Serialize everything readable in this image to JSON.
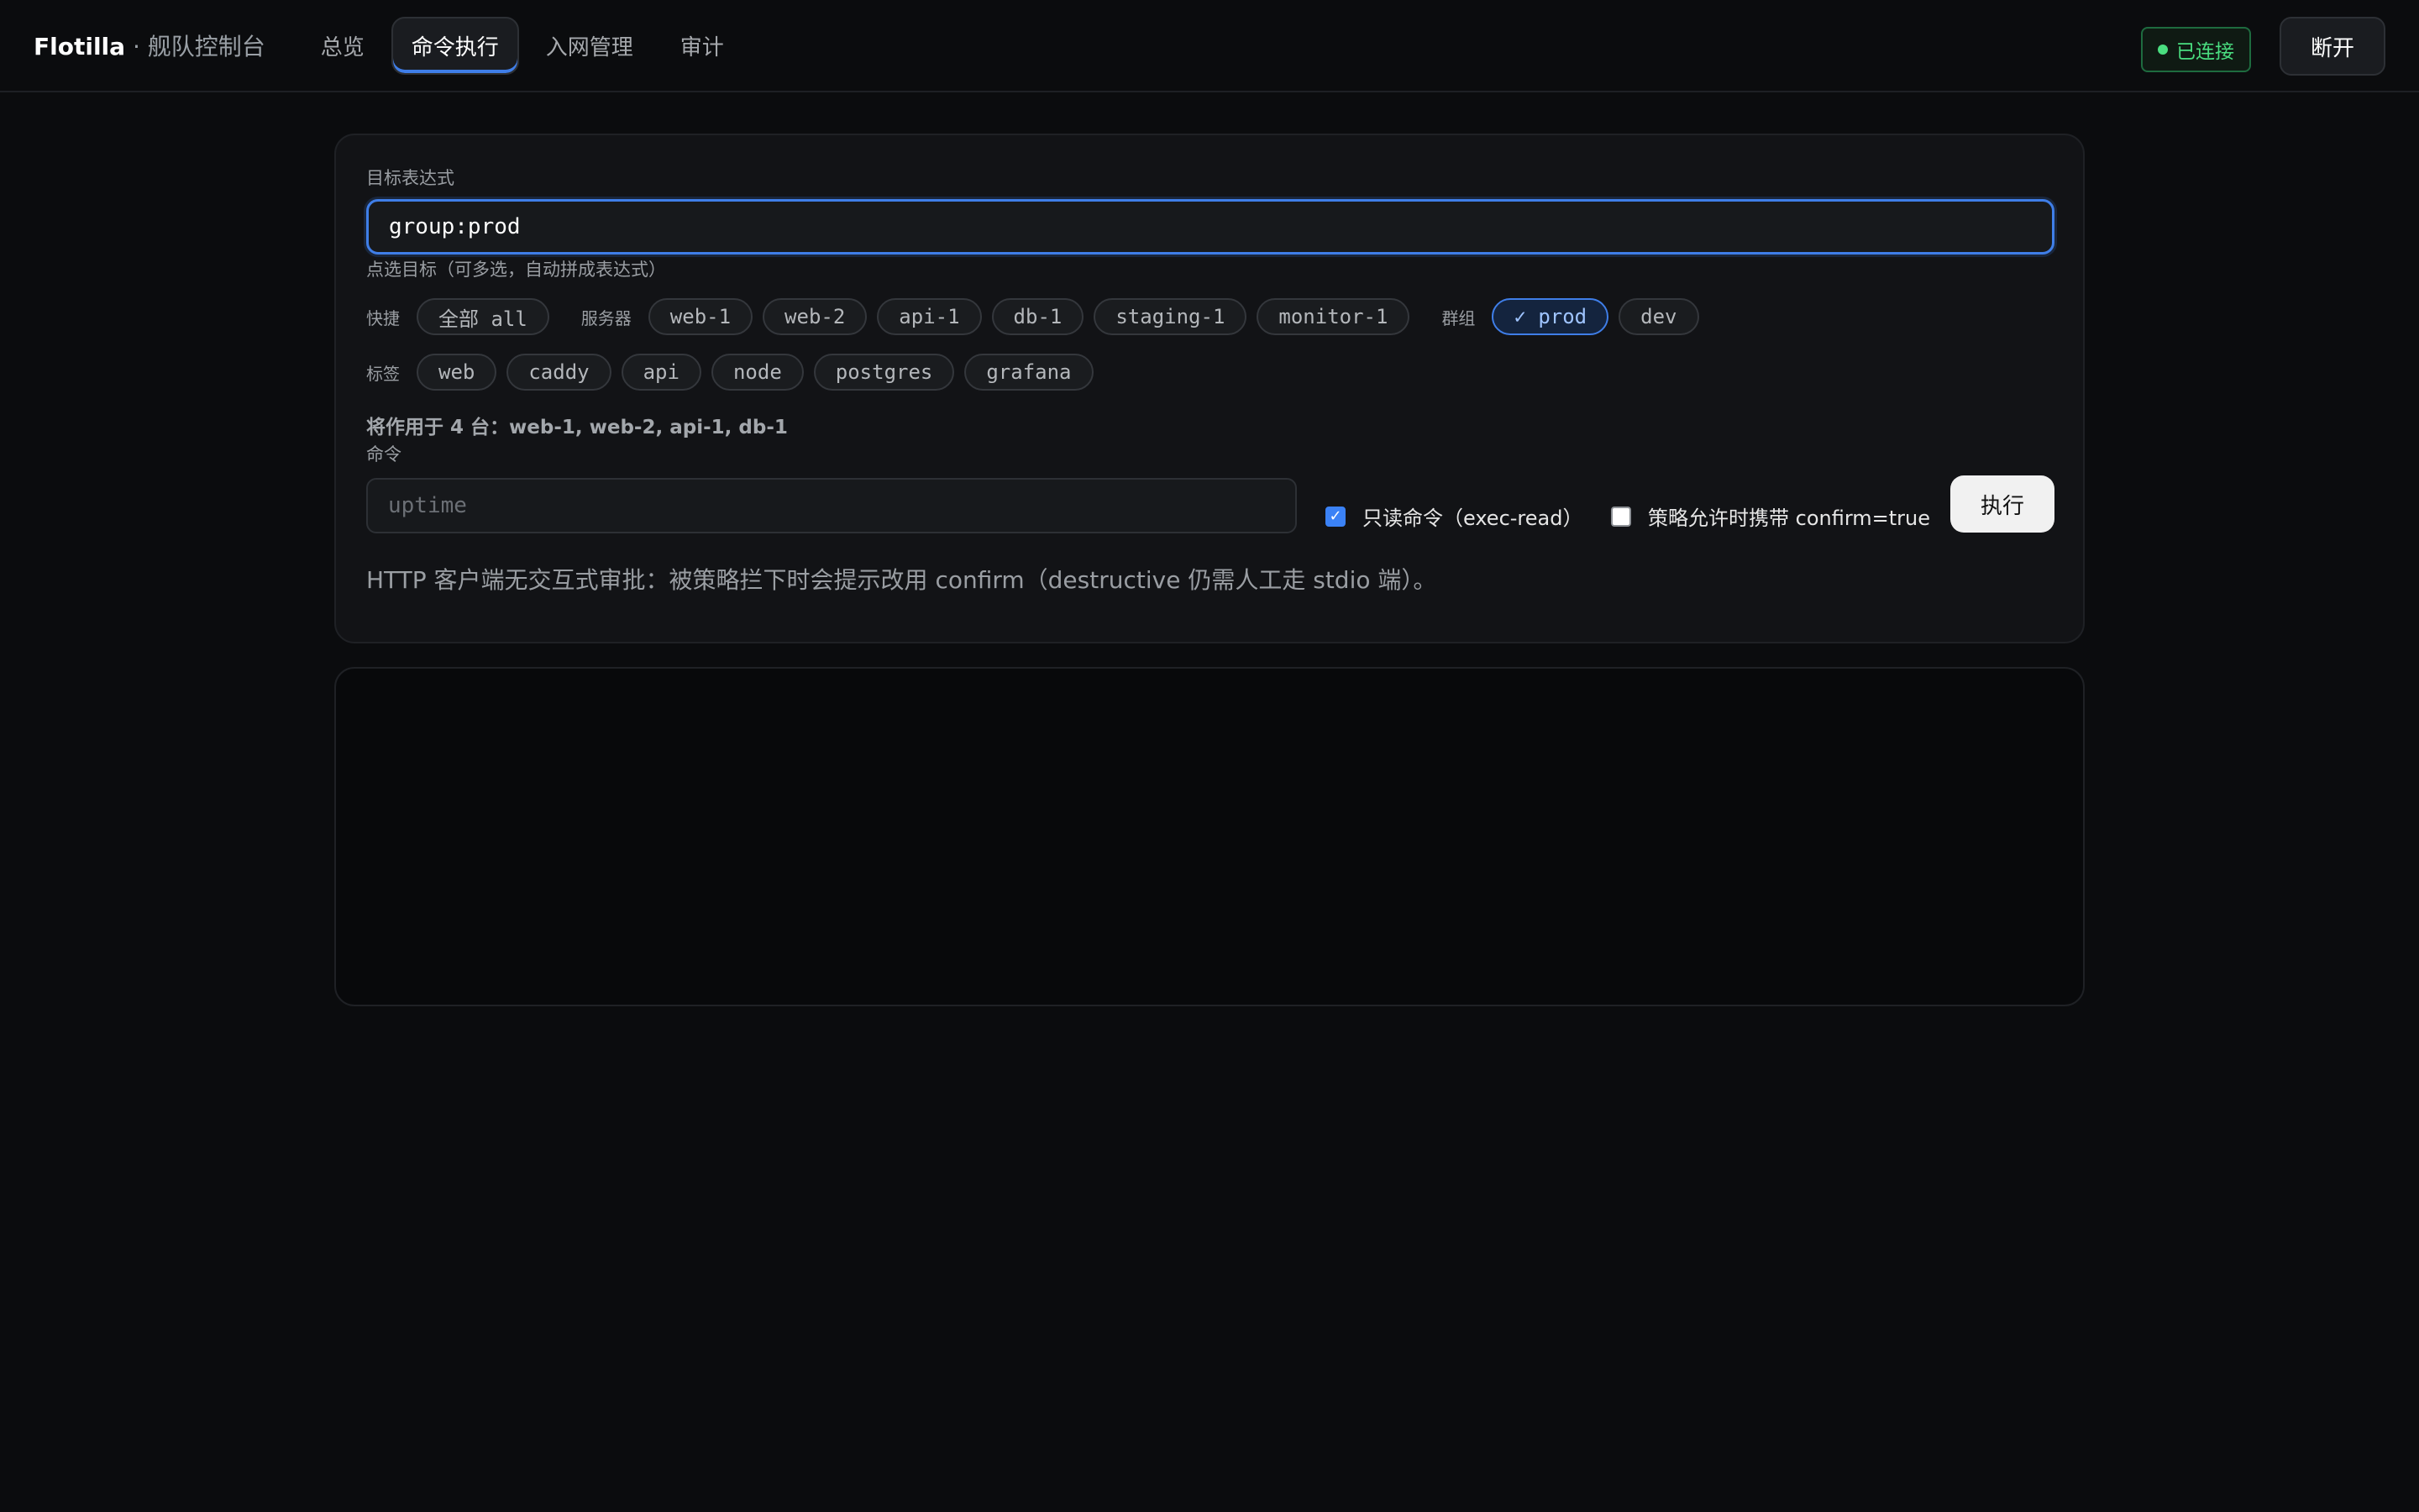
{
  "app": {
    "name": "Flotilla",
    "subtitle": " · 舰队控制台"
  },
  "nav": {
    "tabs": [
      {
        "label": "总览"
      },
      {
        "label": "命令执行",
        "active": true
      },
      {
        "label": "入网管理"
      },
      {
        "label": "审计"
      }
    ]
  },
  "status": {
    "label": "已连接",
    "color": "#4ade80"
  },
  "header": {
    "disconnect_label": "断开"
  },
  "form": {
    "target_label": "目标表达式",
    "target_value": "group:prod",
    "pick_hint": "点选目标（可多选，自动拼成表达式）",
    "quick_label": "快捷",
    "quick_chip": "全部 all",
    "servers_label": "服务器",
    "servers": [
      "web-1",
      "web-2",
      "api-1",
      "db-1",
      "staging-1",
      "monitor-1"
    ],
    "groups_label": "群组",
    "groups": [
      {
        "label": "✓ prod",
        "selected": true
      },
      {
        "label": "dev",
        "selected": false
      }
    ],
    "tags_label": "标签",
    "tags": [
      "web",
      "caddy",
      "api",
      "node",
      "postgres",
      "grafana"
    ],
    "apply_text": "将作用于 4 台：web-1, web-2, api-1, db-1",
    "command_label": "命令",
    "command_placeholder": "uptime",
    "readonly_label": "只读命令（exec-read）",
    "readonly_checked": true,
    "confirm_label": "策略允许时携带 confirm=true",
    "confirm_checked": false,
    "execute_label": "执行",
    "hint": "HTTP 客户端无交互式审批：被策略拦下时会提示改用 confirm（destructive 仍需人工走 stdio 端）。"
  },
  "colors": {
    "accent": "#3f7ee8",
    "background": "#0b0c0e",
    "panel": "#121316"
  }
}
